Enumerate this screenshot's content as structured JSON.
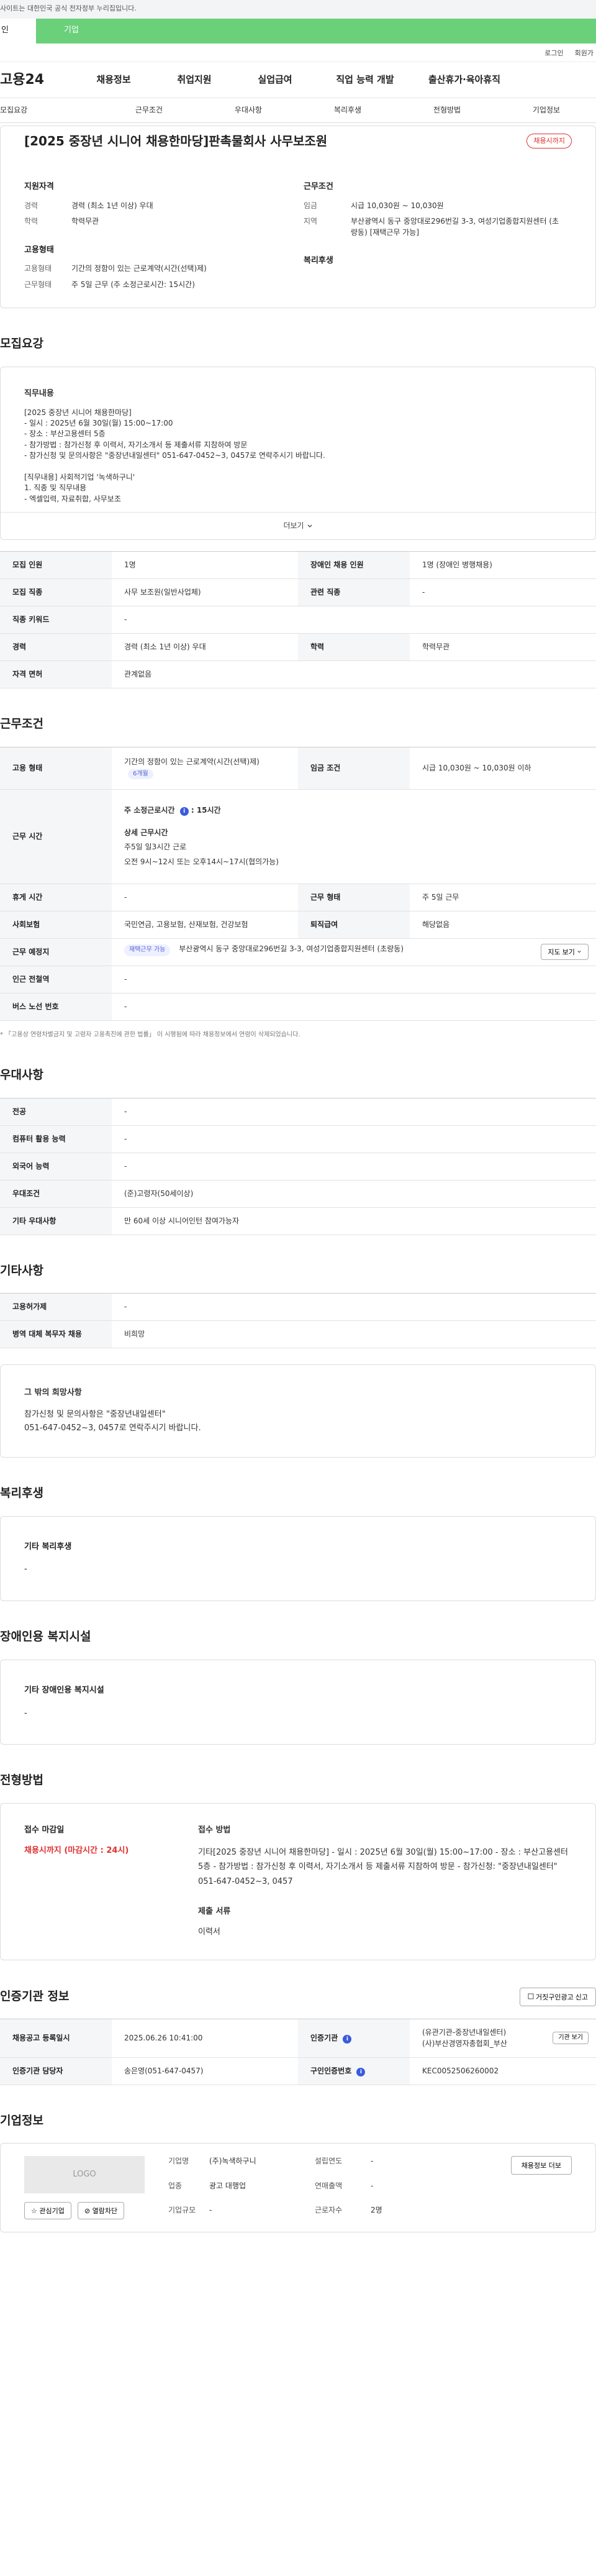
{
  "header": {
    "gov_notice": "사이트는 대한민국 공식 전자정부 누리집입니다.",
    "tab_personal": "인",
    "tab_company": "기업",
    "util": [
      "로그인",
      "회원가"
    ],
    "logo": "고용24",
    "menu": [
      "채용정보",
      "취업지원",
      "실업급여",
      "직업 능력 개발",
      "출산휴가·육아휴직"
    ]
  },
  "anchors": [
    "모집요강",
    "근무조건",
    "우대사항",
    "복리후생",
    "전형방법",
    "기업정보"
  ],
  "summary": {
    "title": "[2025 중장년 시니어 채용한마당]판촉물회사 사무보조원",
    "status": "채용시까지",
    "qual_title": "지원자격",
    "qual": [
      {
        "k": "경력",
        "v": "경력 (최소 1년 이상) 우대"
      },
      {
        "k": "학력",
        "v": "학력무관"
      }
    ],
    "emp_title": "고용형태",
    "emp": [
      {
        "k": "고용형태",
        "v": "기간의 정함이 있는 근로계약(시간(선택)제)"
      },
      {
        "k": "근무형태",
        "v": "주 5일 근무 (주 소정근로시간: 15시간)"
      }
    ],
    "cond_title": "근무조건",
    "cond": [
      {
        "k": "임금",
        "v": "시급 10,030원 ~ 10,030원"
      },
      {
        "k": "지역",
        "v": "부산광역시 동구 중앙대로296번길 3-3, 여성기업종합지원센터 (초량동) [재택근무 가능]"
      }
    ],
    "welfare_title": "복리후생"
  },
  "recruit": {
    "section_title": "모집요강",
    "duty_title": "직무내용",
    "duty_text": "[2025 중장년 시니어 채용한마당]\n- 일시 : 2025년 6월 30일(월) 15:00~17:00\n- 장소 : 부산고용센터 5층\n- 참가방법 : 참가신청 후 이력서, 자기소개서 등 제출서류 지참하여 방문\n- 참가신청 및 문의사항은 \"중장년내일센터\" 051-647-0452~3, 0457로 연락주시기 바랍니다.\n\n[직무내용] 사회적기업 '녹색하구니'\n1. 직종 및 직무내용\n- 엑셀입력, 자료취합, 사무보조",
    "more": "더보기",
    "rows": [
      {
        "k1": "모집 인원",
        "v1": "1명",
        "k2": "장애인 채용 인원",
        "v2": "1명 (장애인 병행채용)"
      },
      {
        "k1": "모집 직종",
        "v1": "사무 보조원(일반사업체)",
        "k2": "관련 직종",
        "v2": "-"
      },
      {
        "k1": "직종 키워드",
        "v1": "-"
      },
      {
        "k1": "경력",
        "v1": "경력 (최소 1년 이상) 우대",
        "k2": "학력",
        "v2": "학력무관"
      },
      {
        "k1": "자격 면허",
        "v1": "관계없음"
      }
    ]
  },
  "condition": {
    "section_title": "근무조건",
    "emp_k": "고용 형태",
    "emp_v": "기간의 정함이 있는 근로계약(시간(선택)제)",
    "emp_badge": "6개월",
    "wage_k": "임금 조건",
    "wage_v": "시급 10,030원 ~ 10,030원 이하",
    "time_k": "근무 시간",
    "time_week": "주 소정근로시간",
    "time_hours": ": 15시간",
    "time_detail_title": "상세 근무시간",
    "time_detail_1": "주5일 일3시간 근로",
    "time_detail_2": "오전 9시~12시 또는 오후14시~17시(협의가능)",
    "rest_k": "휴게 시간",
    "rest_v": "-",
    "form_k": "근무 형태",
    "form_v": "주 5일 근무",
    "ins_k": "사회보험",
    "ins_v": "국민연금, 고용보험, 산재보험, 건강보험",
    "sev_k": "퇴직급여",
    "sev_v": "해당없음",
    "place_k": "근무 예정지",
    "place_badge": "재택근무 가능",
    "place_v": "부산광역시 동구 중앙대로296번길 3-3, 여성기업종합지원센터 (초량동)",
    "map_btn": "지도 보기",
    "station_k": "인근 전철역",
    "station_v": "-",
    "bus_k": "버스 노선 번호",
    "bus_v": "-",
    "note": "* 「고용상 연령차별금지 및 고령자 고용촉진에 관한 법률」 이 시행됨에 따라 채용정보에서 연령이 삭제되었습니다."
  },
  "pref": {
    "section_title": "우대사항",
    "rows": [
      {
        "k": "전공",
        "v": "-"
      },
      {
        "k": "컴퓨터 활용 능력",
        "v": "-"
      },
      {
        "k": "외국어 능력",
        "v": "-"
      },
      {
        "k": "우대조건",
        "v": "(준)고령자(50세이상)"
      },
      {
        "k": "기타 우대사항",
        "v": "만 60세 이상 시니어인턴 참여가능자"
      }
    ]
  },
  "etc": {
    "section_title": "기타사항",
    "rows": [
      {
        "k": "고용허가제",
        "v": "-"
      },
      {
        "k": "병역 대체 복무자 채용",
        "v": "비희망"
      }
    ],
    "box_title": "그 밖의 희망사항",
    "box_text_1": "참가신청 및 문의사항은 \"중장년내일센터\"",
    "box_text_2": "051-647-0452~3, 0457로 연락주시기 바랍니다."
  },
  "welfare": {
    "section_title": "복리후생",
    "box_title": "기타 복리후생",
    "box_text": "-"
  },
  "disabled": {
    "section_title": "장애인용 복지시설",
    "box_title": "기타 장애인용 복지시설",
    "box_text": "-"
  },
  "process": {
    "section_title": "전형방법",
    "deadline_title": "접수 마감일",
    "deadline_text": "채용시까지 (마감시간 : 24시)",
    "method_title": "접수 방법",
    "method_text": "기타[2025 중장년 시니어 채용한마당] - 일시 : 2025년 6월 30일(월) 15:00~17:00 - 장소 : 부산고용센터 5층 - 참가방법 : 참가신청 후 이력서, 자기소개서 등 제출서류 지참하여 방문 - 참가신청: \"중장년내일센터\" 051-647-0452~3, 0457",
    "docs_title": "제출 서류",
    "docs_text": "이력서"
  },
  "cert": {
    "section_title": "인증기관 정보",
    "report_btn": "거짓구인광고 신고",
    "reg_k": "채용공고 등록일시",
    "reg_v": "2025.06.26 10:41:00",
    "inst_k": "인증기관",
    "inst_v1": "(유관기관-중장년내일센터)",
    "inst_v2": "(사)부산경영자총협회_부산",
    "inst_btn": "기관 보기",
    "mgr_k": "인증기관 담당자",
    "mgr_v": "송은영(051-647-0457)",
    "no_k": "구인인증번호",
    "no_v": "KEC0052506260002"
  },
  "company": {
    "section_title": "기업정보",
    "logo": "LOGO",
    "fav_btn": "관심기업",
    "block_btn": "열람차단",
    "other_btn": "채용정보 더보",
    "fields": [
      {
        "k": "기업명",
        "v": "(주)녹색하구니",
        "k2": "설립연도",
        "v2": "-"
      },
      {
        "k": "업종",
        "v": "광고 대행업",
        "k2": "연매출액",
        "v2": "-"
      },
      {
        "k": "기업규모",
        "v": "-",
        "k2": "근로자수",
        "v2": "2명"
      }
    ]
  },
  "icons": {
    "info": "info-icon",
    "chevron": "chevron-down-icon",
    "heart": "star-icon",
    "block": "block-icon",
    "report": "report-icon"
  }
}
